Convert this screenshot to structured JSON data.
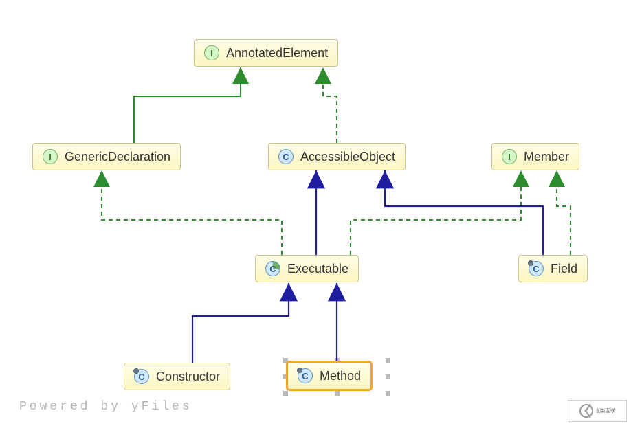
{
  "nodes": {
    "annotatedElement": {
      "label": "AnnotatedElement",
      "iconType": "I"
    },
    "genericDeclaration": {
      "label": "GenericDeclaration",
      "iconType": "I"
    },
    "accessibleObject": {
      "label": "AccessibleObject",
      "iconType": "C"
    },
    "member": {
      "label": "Member",
      "iconType": "I"
    },
    "executable": {
      "label": "Executable",
      "iconType": "C"
    },
    "field": {
      "label": "Field",
      "iconType": "C"
    },
    "constructor": {
      "label": "Constructor",
      "iconType": "C"
    },
    "method": {
      "label": "Method",
      "iconType": "C"
    }
  },
  "footer": "Powered by yFiles",
  "logo": "创新互联"
}
